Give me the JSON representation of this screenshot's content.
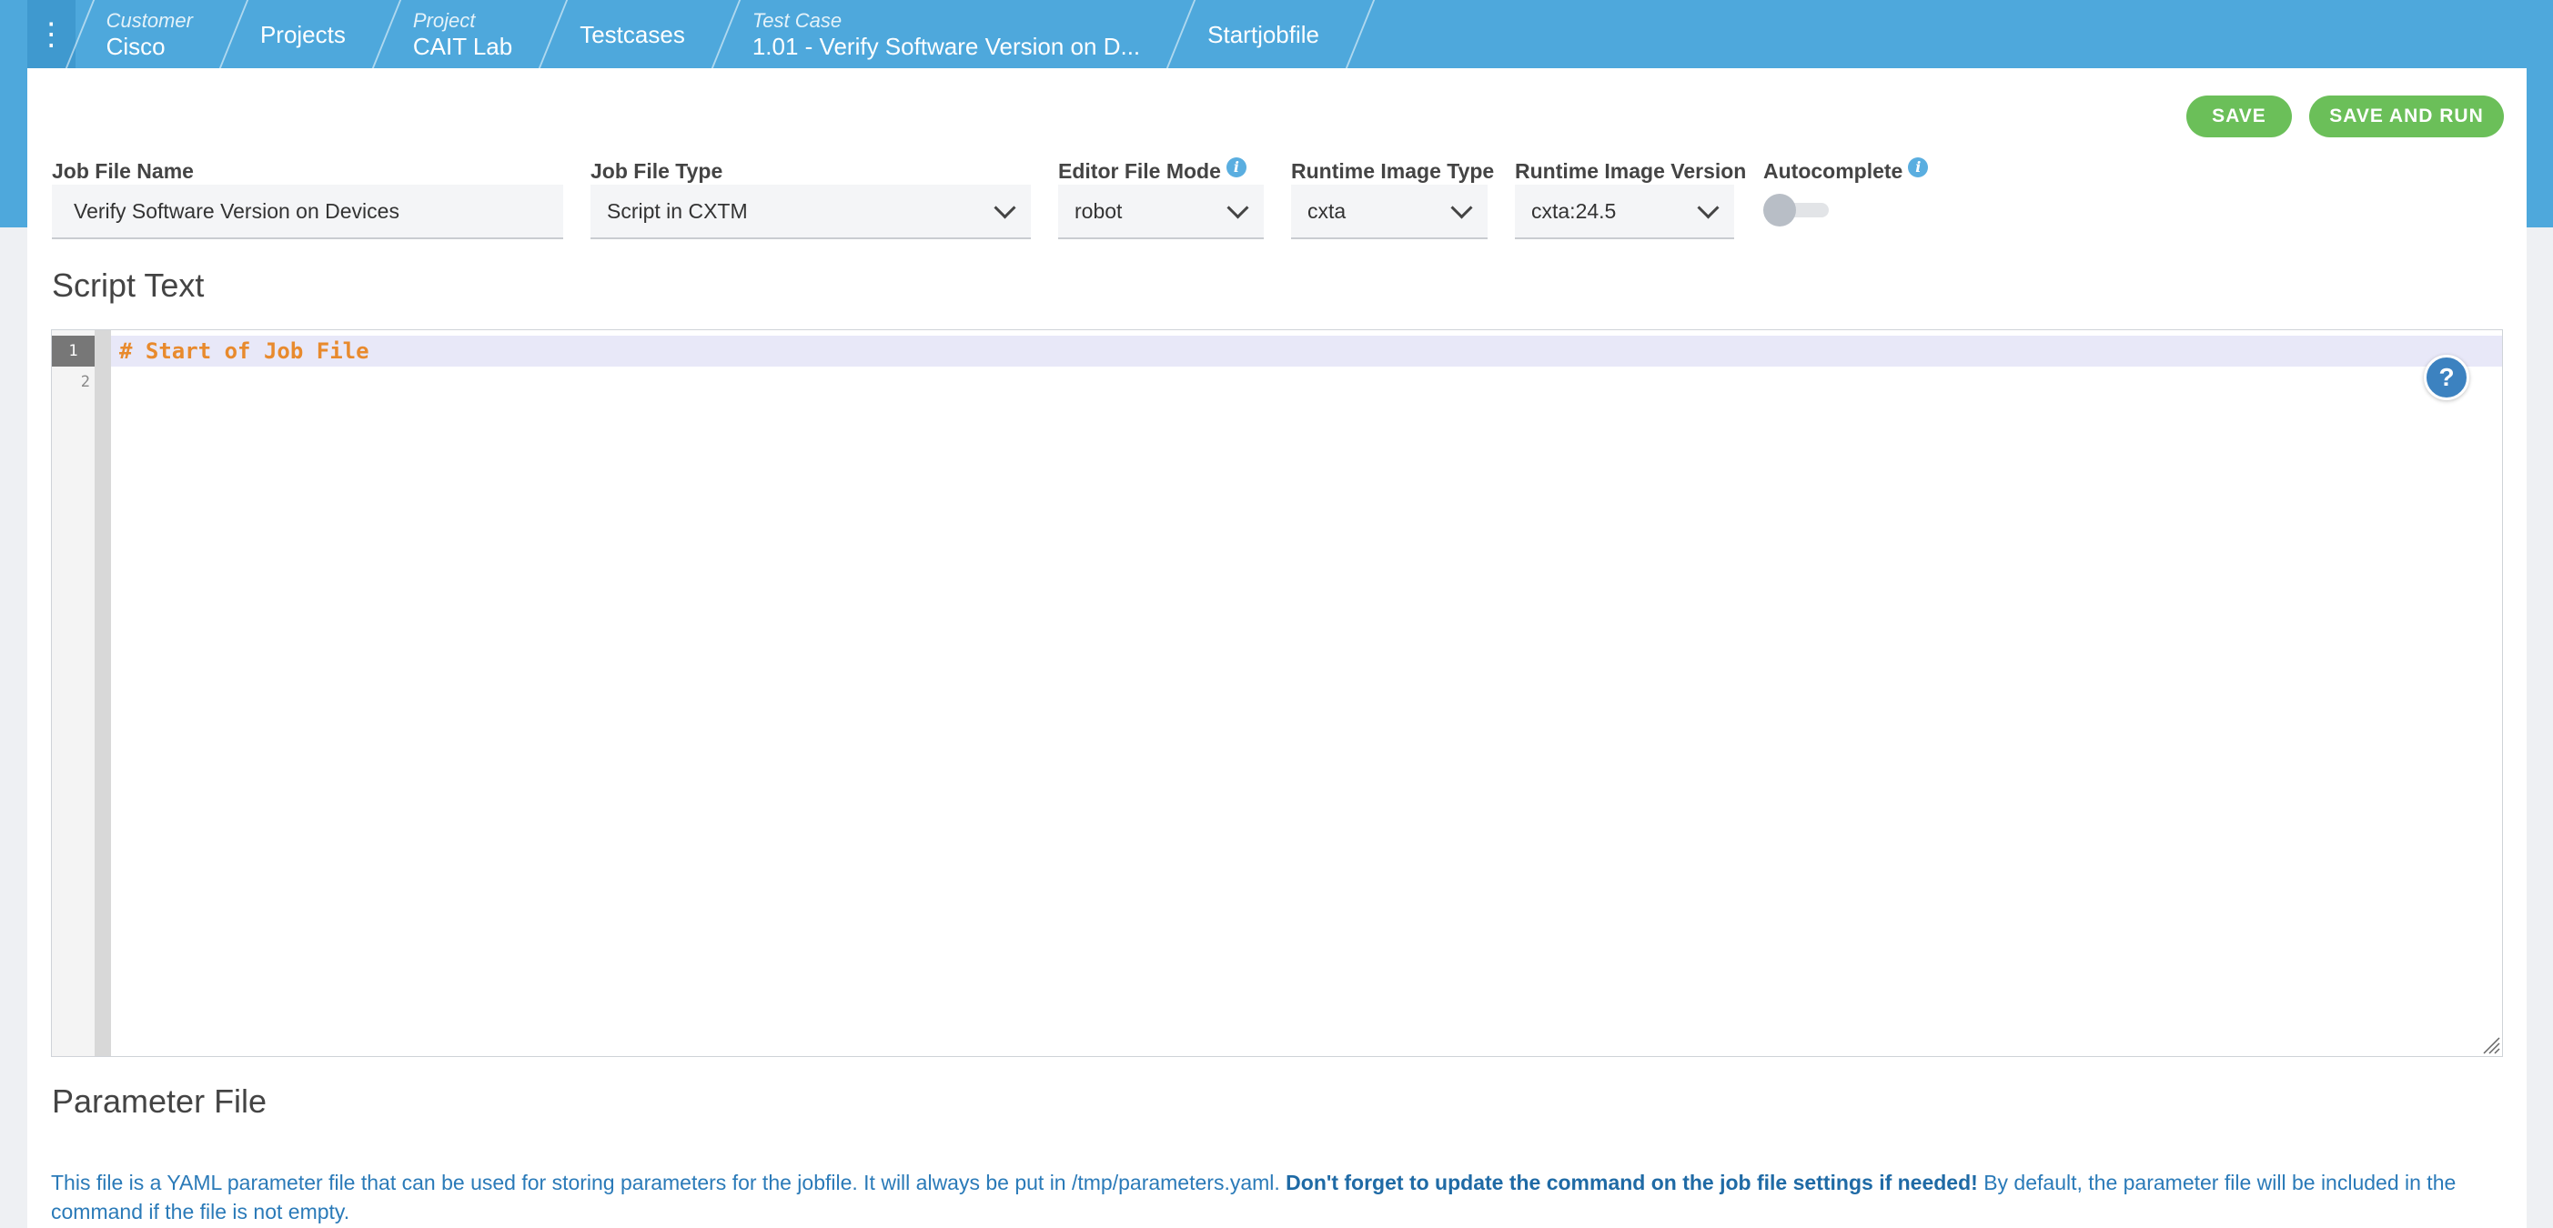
{
  "breadcrumb": {
    "menu_icon": "more-vertical-icon",
    "items": [
      {
        "small": "Customer",
        "main": "Cisco"
      },
      {
        "small": "",
        "main": "Projects"
      },
      {
        "small": "Project",
        "main": "CAIT Lab"
      },
      {
        "small": "",
        "main": "Testcases"
      },
      {
        "small": "Test Case",
        "main": "1.01 - Verify Software Version on D..."
      },
      {
        "small": "",
        "main": "Startjobfile"
      }
    ]
  },
  "actions": {
    "save_label": "SAVE",
    "save_run_label": "SAVE AND RUN"
  },
  "form": {
    "job_file_name": {
      "label": "Job File Name",
      "value": "Verify Software Version on Devices"
    },
    "job_file_type": {
      "label": "Job File Type",
      "value": "Script in CXTM"
    },
    "editor_file_mode": {
      "label": "Editor File Mode",
      "value": "robot"
    },
    "runtime_image_type": {
      "label": "Runtime Image Type",
      "value": "cxta"
    },
    "runtime_image_version": {
      "label": "Runtime Image Version",
      "value": "cxta:24.5"
    },
    "autocomplete": {
      "label": "Autocomplete",
      "enabled": false
    }
  },
  "script": {
    "title": "Script Text",
    "lines": [
      "# Start of Job File",
      ""
    ],
    "line_numbers": [
      "1",
      "2"
    ],
    "help_label": "?"
  },
  "parameter": {
    "title": "Parameter File",
    "desc_1": "This file is a YAML parameter file that can be used for storing parameters for the jobfile. It will always be put in /tmp/parameters.yaml. ",
    "desc_bold": "Don't forget to update the command on the job file settings if needed!",
    "desc_2": " By default, the parameter file will be included in the command if the file is not empty."
  },
  "colors": {
    "accent": "#4ea8dc",
    "button": "#6bbf59",
    "code": "#e88a2d",
    "link_text": "#2a7ab8"
  }
}
